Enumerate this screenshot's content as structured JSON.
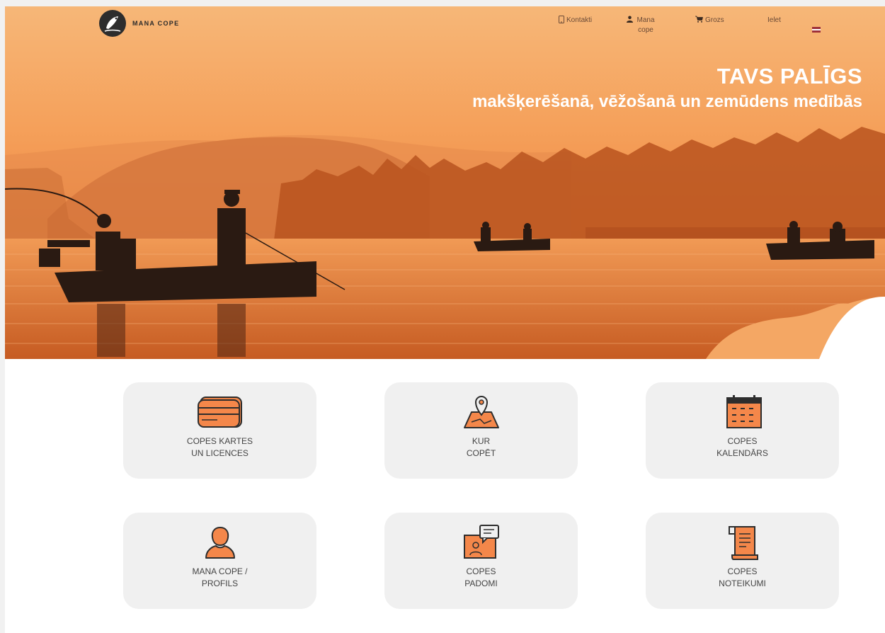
{
  "brand": {
    "name": "MANA COPE"
  },
  "nav": {
    "contacts": "Kontakti",
    "account": "Mana cope",
    "cart": "Grozs",
    "login": "Ielet",
    "language_icon": "latvian-flag-icon"
  },
  "hero": {
    "title": "TAVS PALĪGS",
    "subtitle": "makšķerēšanā, vēžošanā un zemūdens medībās"
  },
  "tiles": [
    {
      "line1": "COPES KARTES",
      "line2": "UN LICENCES",
      "icon": "cards-icon"
    },
    {
      "line1": "KUR",
      "line2": "COPĒT",
      "icon": "map-pin-icon"
    },
    {
      "line1": "COPES",
      "line2": "KALENDĀRS",
      "icon": "calendar-icon"
    },
    {
      "line1": "MANA COPE /",
      "line2": "PROFILS",
      "icon": "user-profile-icon"
    },
    {
      "line1": "COPES",
      "line2": "PADOMI",
      "icon": "advice-icon"
    },
    {
      "line1": "COPES",
      "line2": "NOTEIKUMI",
      "icon": "rules-document-icon"
    }
  ],
  "colors": {
    "accent": "#f4874a",
    "hero_sky": "#f5a462",
    "hero_deep": "#c4551f",
    "tile_bg": "#f0f0f0",
    "text": "#444444"
  }
}
